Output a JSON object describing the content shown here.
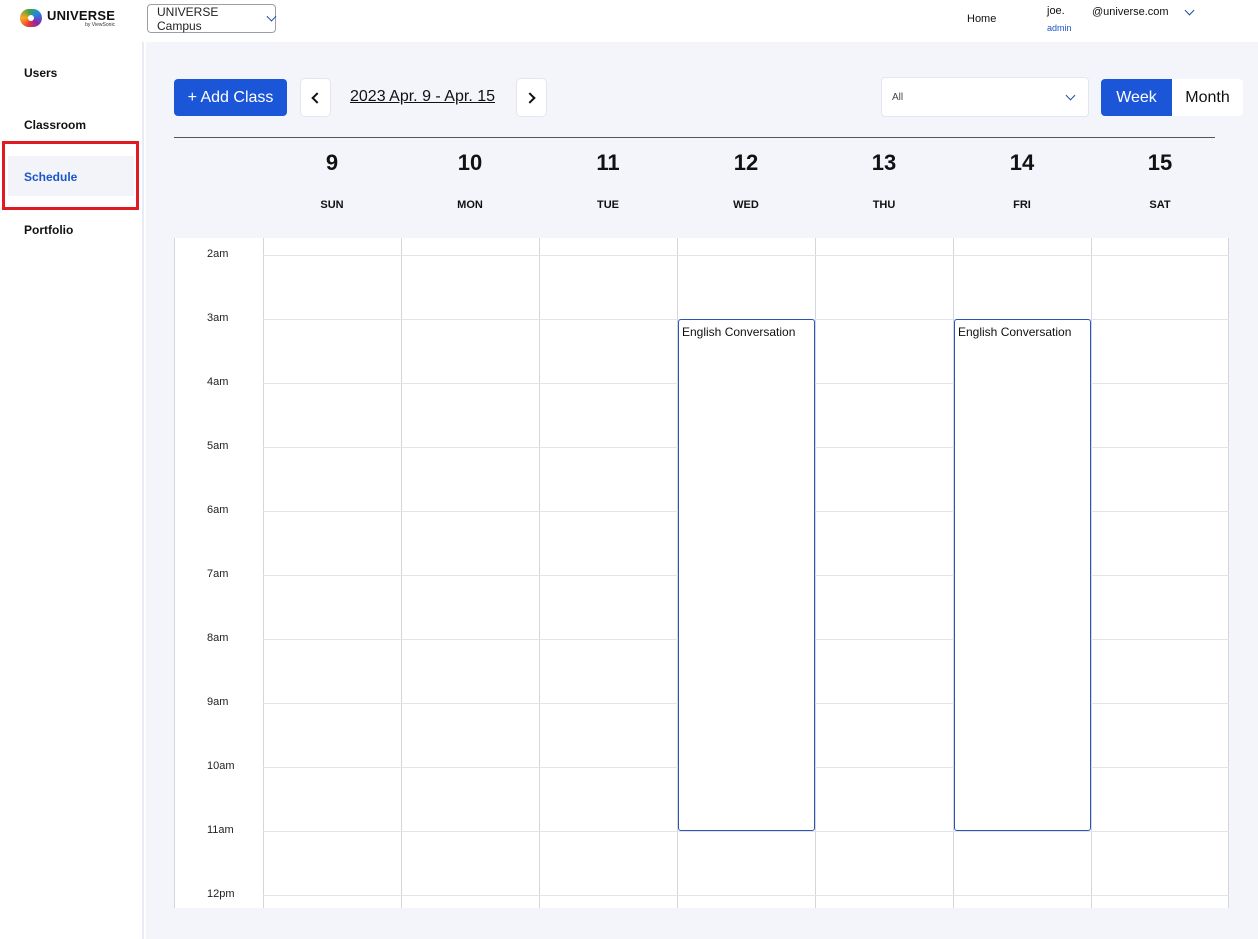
{
  "app": {
    "logo_name": "UNIVERSE",
    "logo_sub": "by ViewSonic",
    "campus": "UNIVERSE Campus",
    "nav_home": "Home",
    "user_name": "joe.",
    "user_email": "@universe.com",
    "user_role": "admin"
  },
  "sidebar": {
    "items": [
      {
        "label": "Users"
      },
      {
        "label": "Classroom"
      },
      {
        "label": "Schedule",
        "active": true
      },
      {
        "label": "Portfolio"
      }
    ]
  },
  "toolbar": {
    "add_class": "+ Add Class",
    "date_range": "2023 Apr. 9 - Apr. 15",
    "filter": "All",
    "view_week": "Week",
    "view_month": "Month",
    "active_view": "Week"
  },
  "calendar": {
    "days": [
      {
        "num": "9",
        "name": "SUN"
      },
      {
        "num": "10",
        "name": "MON"
      },
      {
        "num": "11",
        "name": "TUE"
      },
      {
        "num": "12",
        "name": "WED"
      },
      {
        "num": "13",
        "name": "THU"
      },
      {
        "num": "14",
        "name": "FRI"
      },
      {
        "num": "15",
        "name": "SAT"
      }
    ],
    "times": [
      "2am",
      "3am",
      "4am",
      "5am",
      "6am",
      "7am",
      "8am",
      "9am",
      "10am",
      "11am",
      "12pm"
    ],
    "events": [
      {
        "title": "English Conversation",
        "day": "WED",
        "start": "3am",
        "end": "11am"
      },
      {
        "title": "English Conversation",
        "day": "FRI",
        "start": "3am",
        "end": "11am"
      }
    ]
  },
  "colors": {
    "accent": "#1b56d8",
    "highlight": "#e11b22",
    "event_border": "#2a55b3"
  }
}
